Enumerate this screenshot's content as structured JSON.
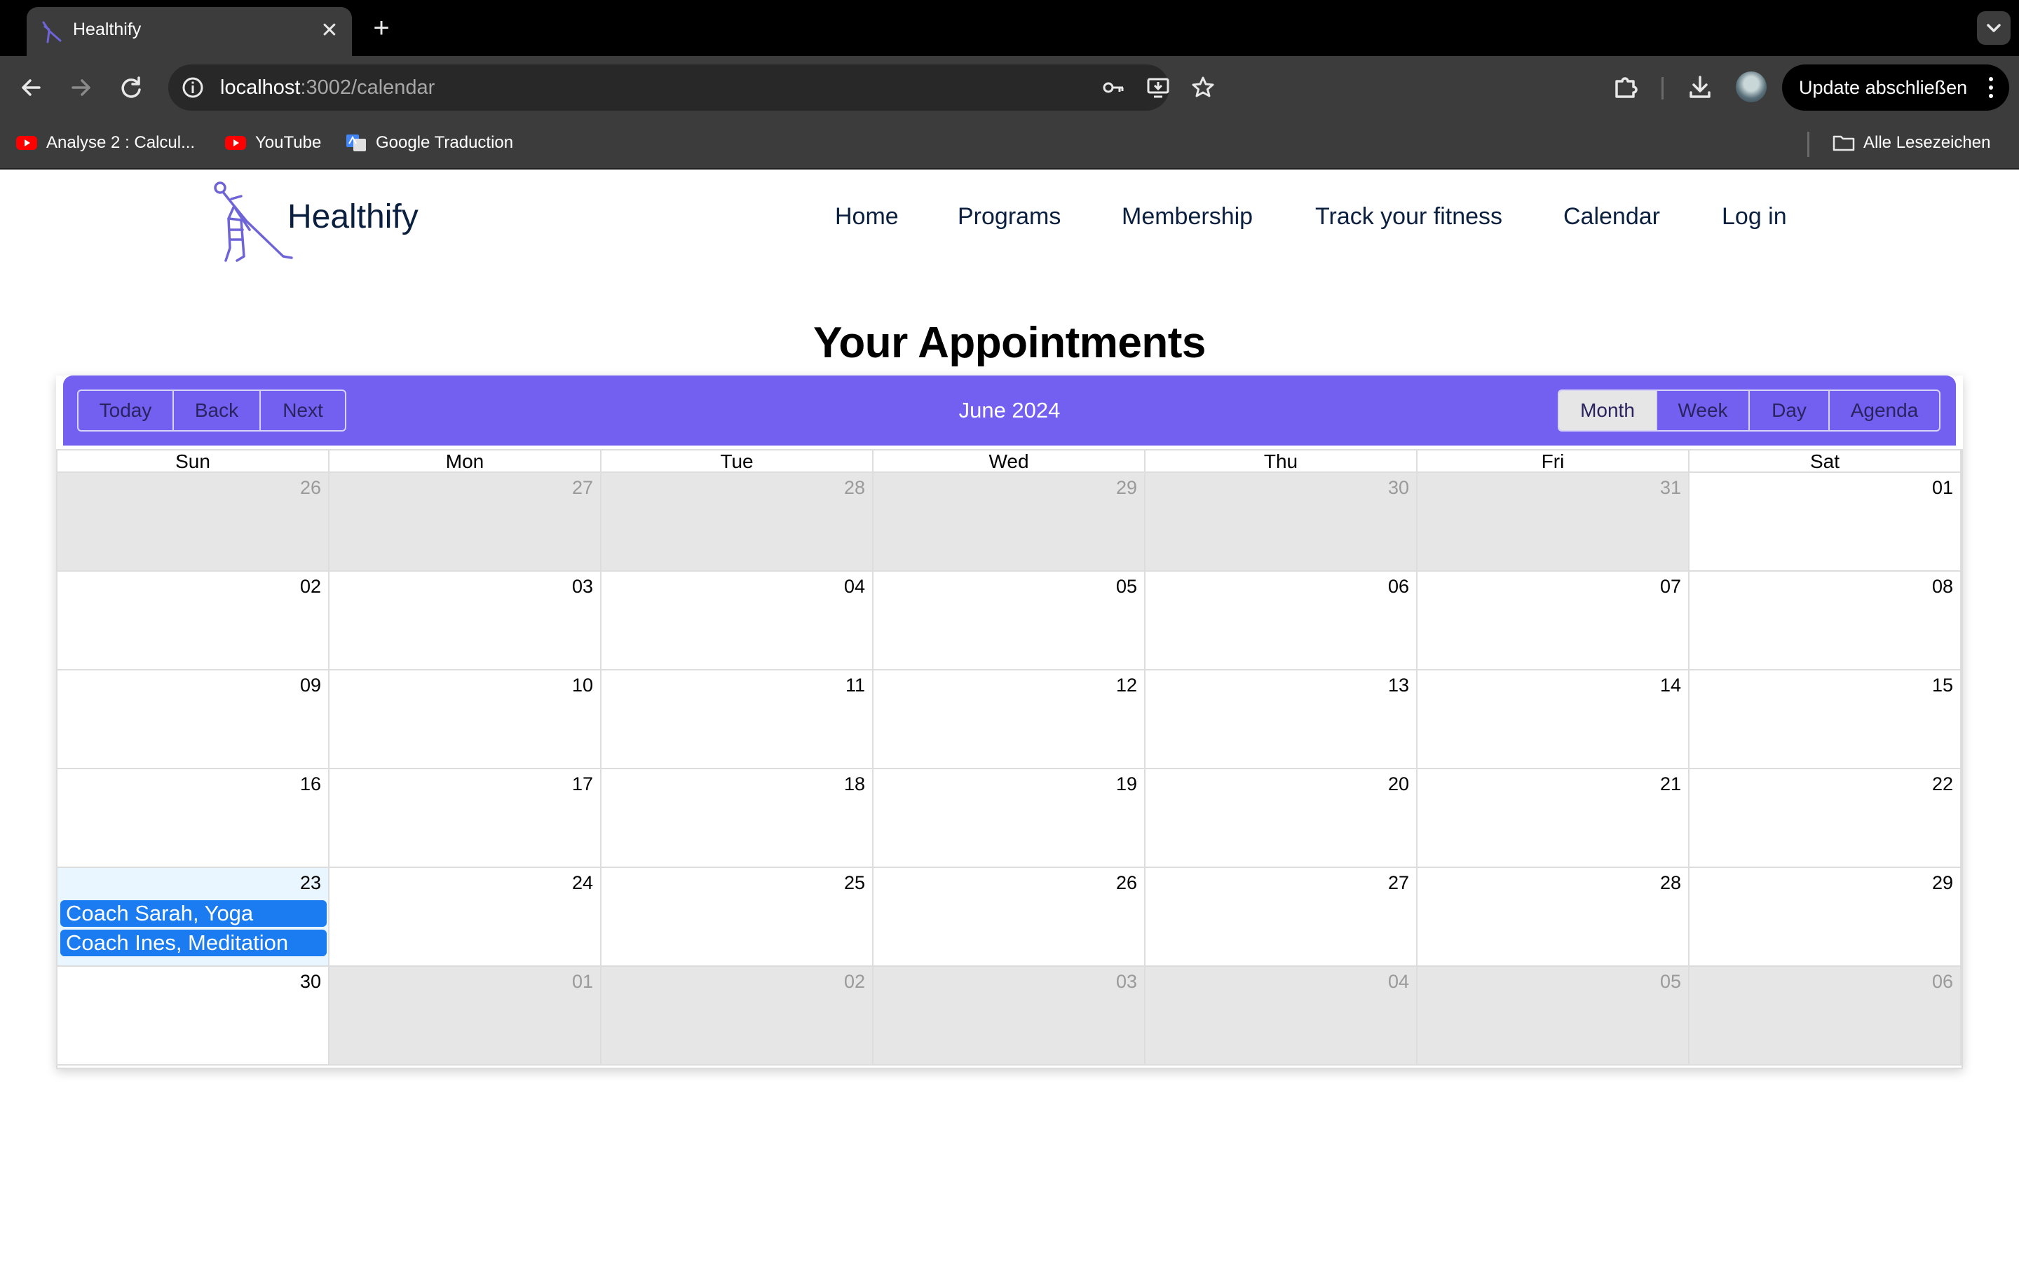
{
  "browser": {
    "tab_title": "Healthify",
    "new_tab_symbol": "+",
    "close_symbol": "✕",
    "url_host": "localhost",
    "url_path": ":3002/calendar",
    "update_label": "Update abschließen",
    "bookmarks": [
      {
        "label": "Analyse 2 : Calcul...",
        "icon": "youtube-icon"
      },
      {
        "label": "YouTube",
        "icon": "youtube-icon"
      },
      {
        "label": "Google Traduction",
        "icon": "google-translate-icon"
      }
    ],
    "all_bookmarks_label": "Alle Lesezeichen"
  },
  "site": {
    "brand": "Healthify",
    "nav": [
      "Home",
      "Programs",
      "Membership",
      "Track your fitness",
      "Calendar",
      "Log in"
    ]
  },
  "page": {
    "title": "Your Appointments"
  },
  "calendar": {
    "label": "June 2024",
    "nav_buttons": [
      "Today",
      "Back",
      "Next"
    ],
    "view_buttons": [
      "Month",
      "Week",
      "Day",
      "Agenda"
    ],
    "active_view": "Month",
    "weekdays": [
      "Sun",
      "Mon",
      "Tue",
      "Wed",
      "Thu",
      "Fri",
      "Sat"
    ],
    "weeks": [
      [
        "26",
        "27",
        "28",
        "29",
        "30",
        "31",
        "01"
      ],
      [
        "02",
        "03",
        "04",
        "05",
        "06",
        "07",
        "08"
      ],
      [
        "09",
        "10",
        "11",
        "12",
        "13",
        "14",
        "15"
      ],
      [
        "16",
        "17",
        "18",
        "19",
        "20",
        "21",
        "22"
      ],
      [
        "23",
        "24",
        "25",
        "26",
        "27",
        "28",
        "29"
      ],
      [
        "30",
        "01",
        "02",
        "03",
        "04",
        "05",
        "06"
      ]
    ],
    "off_range": [
      [
        true,
        true,
        true,
        true,
        true,
        true,
        false
      ],
      [
        false,
        false,
        false,
        false,
        false,
        false,
        false
      ],
      [
        false,
        false,
        false,
        false,
        false,
        false,
        false
      ],
      [
        false,
        false,
        false,
        false,
        false,
        false,
        false
      ],
      [
        false,
        false,
        false,
        false,
        false,
        false,
        false
      ],
      [
        false,
        true,
        true,
        true,
        true,
        true,
        true
      ]
    ],
    "today": {
      "week": 4,
      "day": 0
    },
    "events": [
      {
        "title": "Coach Sarah, Yoga",
        "week": 4,
        "day": 0
      },
      {
        "title": "Coach Ines, Meditation",
        "week": 4,
        "day": 0
      }
    ],
    "colors": {
      "toolbar": "#7360f0",
      "event": "#1a7cf0",
      "off_range": "#e6e6e6",
      "today": "#eaf6ff"
    }
  }
}
